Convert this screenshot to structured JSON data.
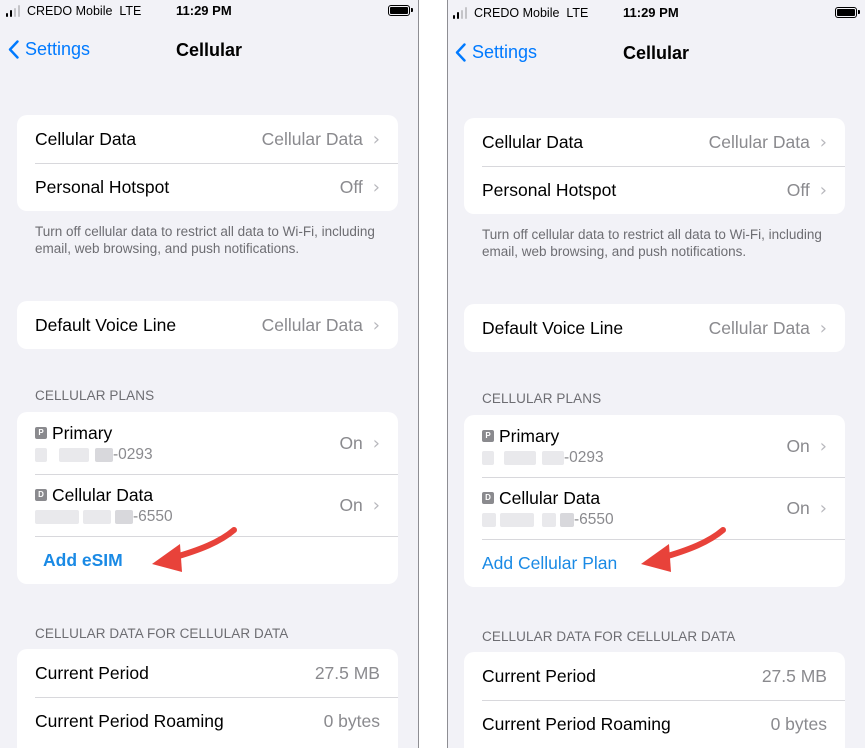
{
  "status": {
    "carrier": "CREDO Mobile",
    "network": "LTE",
    "time": "11:29 PM"
  },
  "nav": {
    "back_label": "Settings",
    "title": "Cellular"
  },
  "group1": {
    "cellular_data": {
      "label": "Cellular Data",
      "value": "Cellular Data"
    },
    "personal_hotspot": {
      "label": "Personal Hotspot",
      "value": "Off"
    }
  },
  "group1_footer": "Turn off cellular data to restrict all data to Wi-Fi, including email, web browsing, and push notifications.",
  "voice": {
    "label": "Default Voice Line",
    "value": "Cellular Data"
  },
  "plans_header": "CELLULAR PLANS",
  "plans": [
    {
      "badge": "P",
      "name": "Primary",
      "number_suffix": "-0293",
      "status": "On"
    },
    {
      "badge": "D",
      "name": "Cellular Data",
      "number_suffix": "-6550",
      "status": "On"
    }
  ],
  "add_left": "Add eSIM",
  "add_right": "Add Cellular Plan",
  "usage_header": "CELLULAR DATA FOR CELLULAR DATA",
  "usage": {
    "current_period": {
      "label": "Current Period",
      "value": "27.5 MB"
    },
    "roaming": {
      "label": "Current Period Roaming",
      "value": "0 bytes"
    }
  },
  "colors": {
    "accent": "#007aff",
    "link": "#1a8ae5",
    "background": "#f2f2f7",
    "arrow": "#e8423a"
  }
}
